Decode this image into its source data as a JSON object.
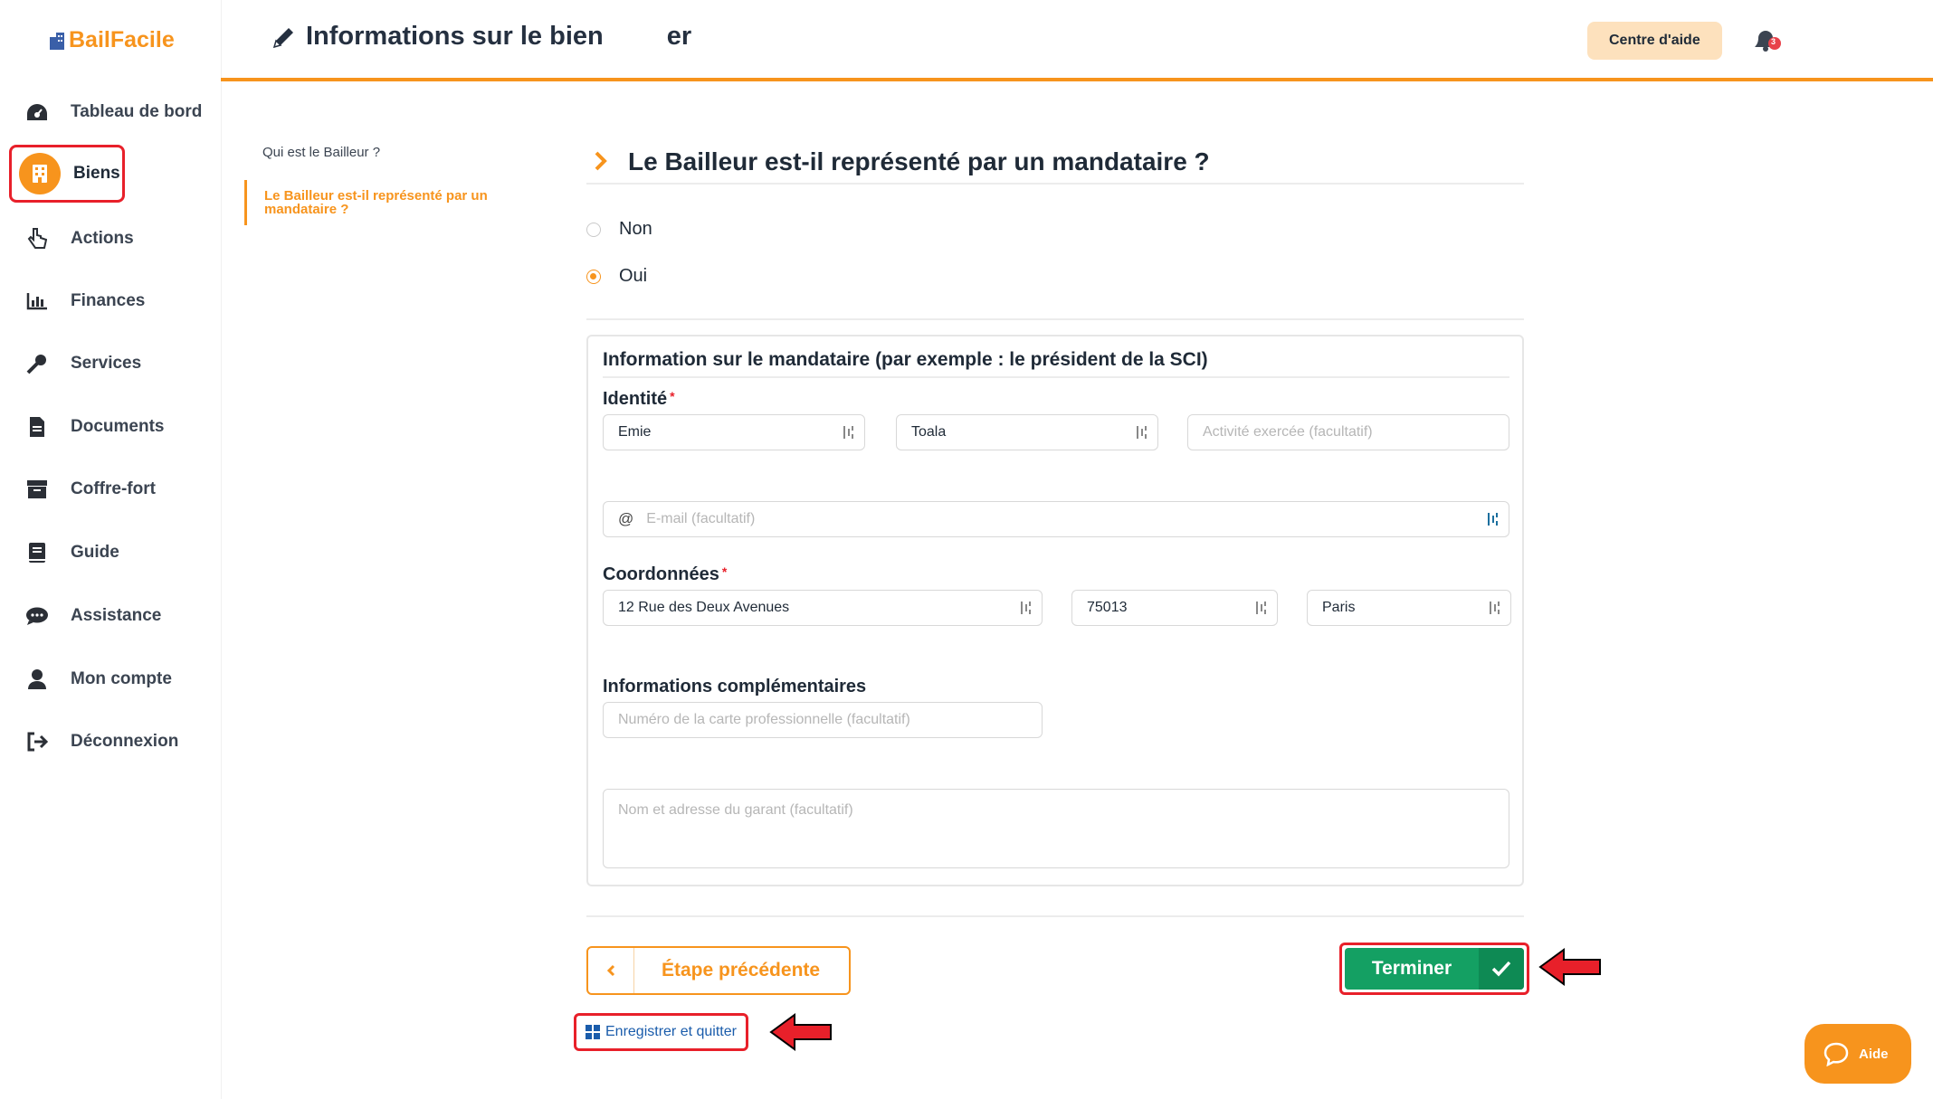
{
  "app": {
    "name": "BailFacile"
  },
  "sidebar": {
    "items": [
      {
        "label": "Tableau de bord",
        "icon": "dashboard-icon"
      },
      {
        "label": "Biens",
        "icon": "building-icon",
        "active": true
      },
      {
        "label": "Actions",
        "icon": "hand-pointer-icon"
      },
      {
        "label": "Finances",
        "icon": "bar-chart-icon"
      },
      {
        "label": "Services",
        "icon": "key-icon"
      },
      {
        "label": "Documents",
        "icon": "file-icon"
      },
      {
        "label": "Coffre-fort",
        "icon": "archive-icon"
      },
      {
        "label": "Guide",
        "icon": "book-icon"
      },
      {
        "label": "Assistance",
        "icon": "chat-icon"
      },
      {
        "label": "Mon compte",
        "icon": "user-icon"
      },
      {
        "label": "Déconnexion",
        "icon": "logout-icon"
      }
    ]
  },
  "header": {
    "title": "Informations sur le bien ",
    "title_suffix": "er",
    "help_center": "Centre d'aide",
    "notification_count": "3"
  },
  "steps": {
    "items": [
      {
        "label": "Qui est le Bailleur ?"
      },
      {
        "label": "Le Bailleur est-il représenté par un mandataire ?",
        "active": true
      }
    ]
  },
  "form": {
    "question": "Le Bailleur est-il représenté par un mandataire ?",
    "options": [
      {
        "label": "Non",
        "checked": false
      },
      {
        "label": "Oui",
        "checked": true
      }
    ],
    "card_title": "Information sur le mandataire (par exemple : le président de la SCI)",
    "identity_label": "Identité",
    "required_mark": "*",
    "first_name": "Emie",
    "last_name": "Toala",
    "activity_placeholder": "Activité exercée (facultatif)",
    "email_placeholder": "E-mail (facultatif)",
    "coords_label": "Coordonnées",
    "address": "12 Rue des Deux Avenues",
    "postal_code": "75013",
    "city": "Paris",
    "extra_label": "Informations complémentaires",
    "card_number_placeholder": "Numéro de la carte professionnelle (facultatif)",
    "guarantor_placeholder": "Nom et adresse du garant (facultatif)"
  },
  "actions": {
    "previous": "Étape précédente",
    "finish": "Terminer",
    "save_quit": "Enregistrer et quitter"
  },
  "widget": {
    "help": "Aide"
  },
  "colors": {
    "accent": "#f7941d",
    "success": "#14a063",
    "highlight": "#e8202a"
  }
}
